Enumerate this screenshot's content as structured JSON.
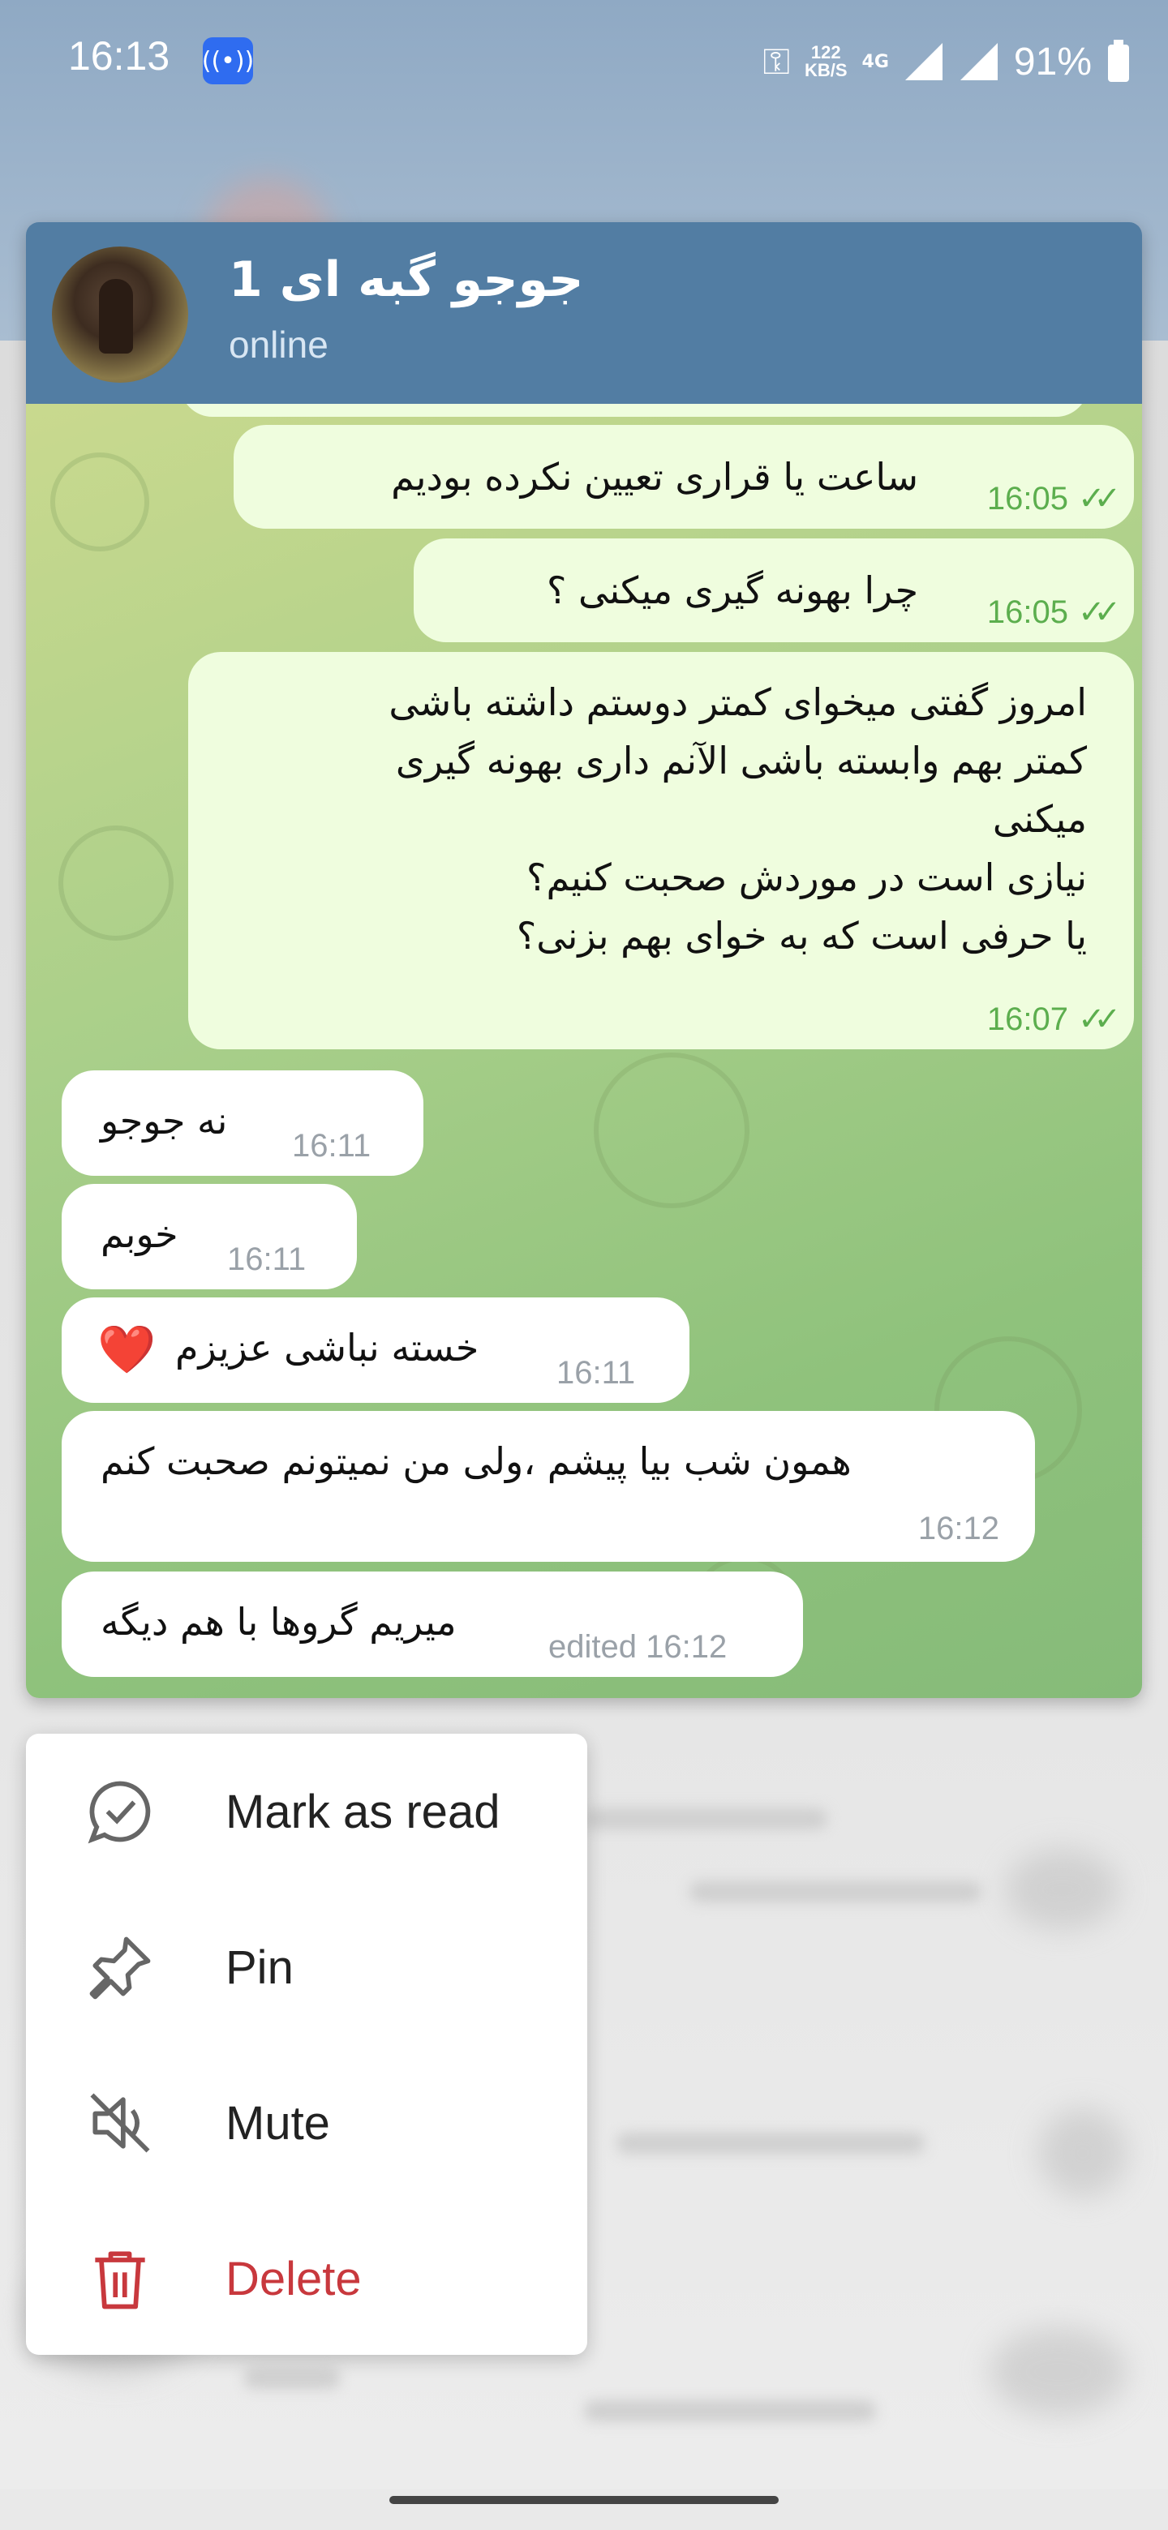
{
  "status_bar": {
    "time": "16:13",
    "speed_value": "122",
    "speed_unit": "KB/S",
    "network": "4G",
    "battery": "91%"
  },
  "chat": {
    "name": "جوجو گبه ای 1",
    "status": "online"
  },
  "messages": [
    {
      "dir": "out",
      "text": "ساعت یا قراری تعیین نکرده بودیم",
      "time": "16:05"
    },
    {
      "dir": "out",
      "text": "چرا بهونه گیری میکنی ؟",
      "time": "16:05"
    },
    {
      "dir": "out",
      "text": "امروز گفتی میخوای کمتر دوستم داشته باشی\nکمتر بهم وابسته باشی الآنم داری بهونه گیری\nمیکنی\nنیازی است در موردش صحبت کنیم؟\nیا حرفی است که به خوای بهم بزنی؟",
      "time": "16:07"
    },
    {
      "dir": "in",
      "text": "نه جوجو",
      "time": "16:11"
    },
    {
      "dir": "in",
      "text": "خوبم",
      "time": "16:11"
    },
    {
      "dir": "in",
      "text": "خسته نباشی عزیزم",
      "time": "16:11",
      "emoji": "❤️"
    },
    {
      "dir": "in",
      "text": "همون شب بیا پیشم ،ولی من نمیتونم صحبت کنم",
      "time": "16:12"
    },
    {
      "dir": "in",
      "text": "میریم گروها با هم دیگه",
      "time": "edited 16:12"
    }
  ],
  "menu": {
    "items": [
      {
        "label": "Mark as read",
        "icon": "message-check-icon"
      },
      {
        "label": "Pin",
        "icon": "pin-icon"
      },
      {
        "label": "Mute",
        "icon": "mute-icon"
      },
      {
        "label": "Delete",
        "icon": "trash-icon"
      }
    ]
  },
  "colors": {
    "header": "#527da3",
    "outgoing_bubble": "#effdde",
    "incoming_bubble": "#ffffff",
    "check": "#5cae4e",
    "danger": "#c8383d"
  }
}
